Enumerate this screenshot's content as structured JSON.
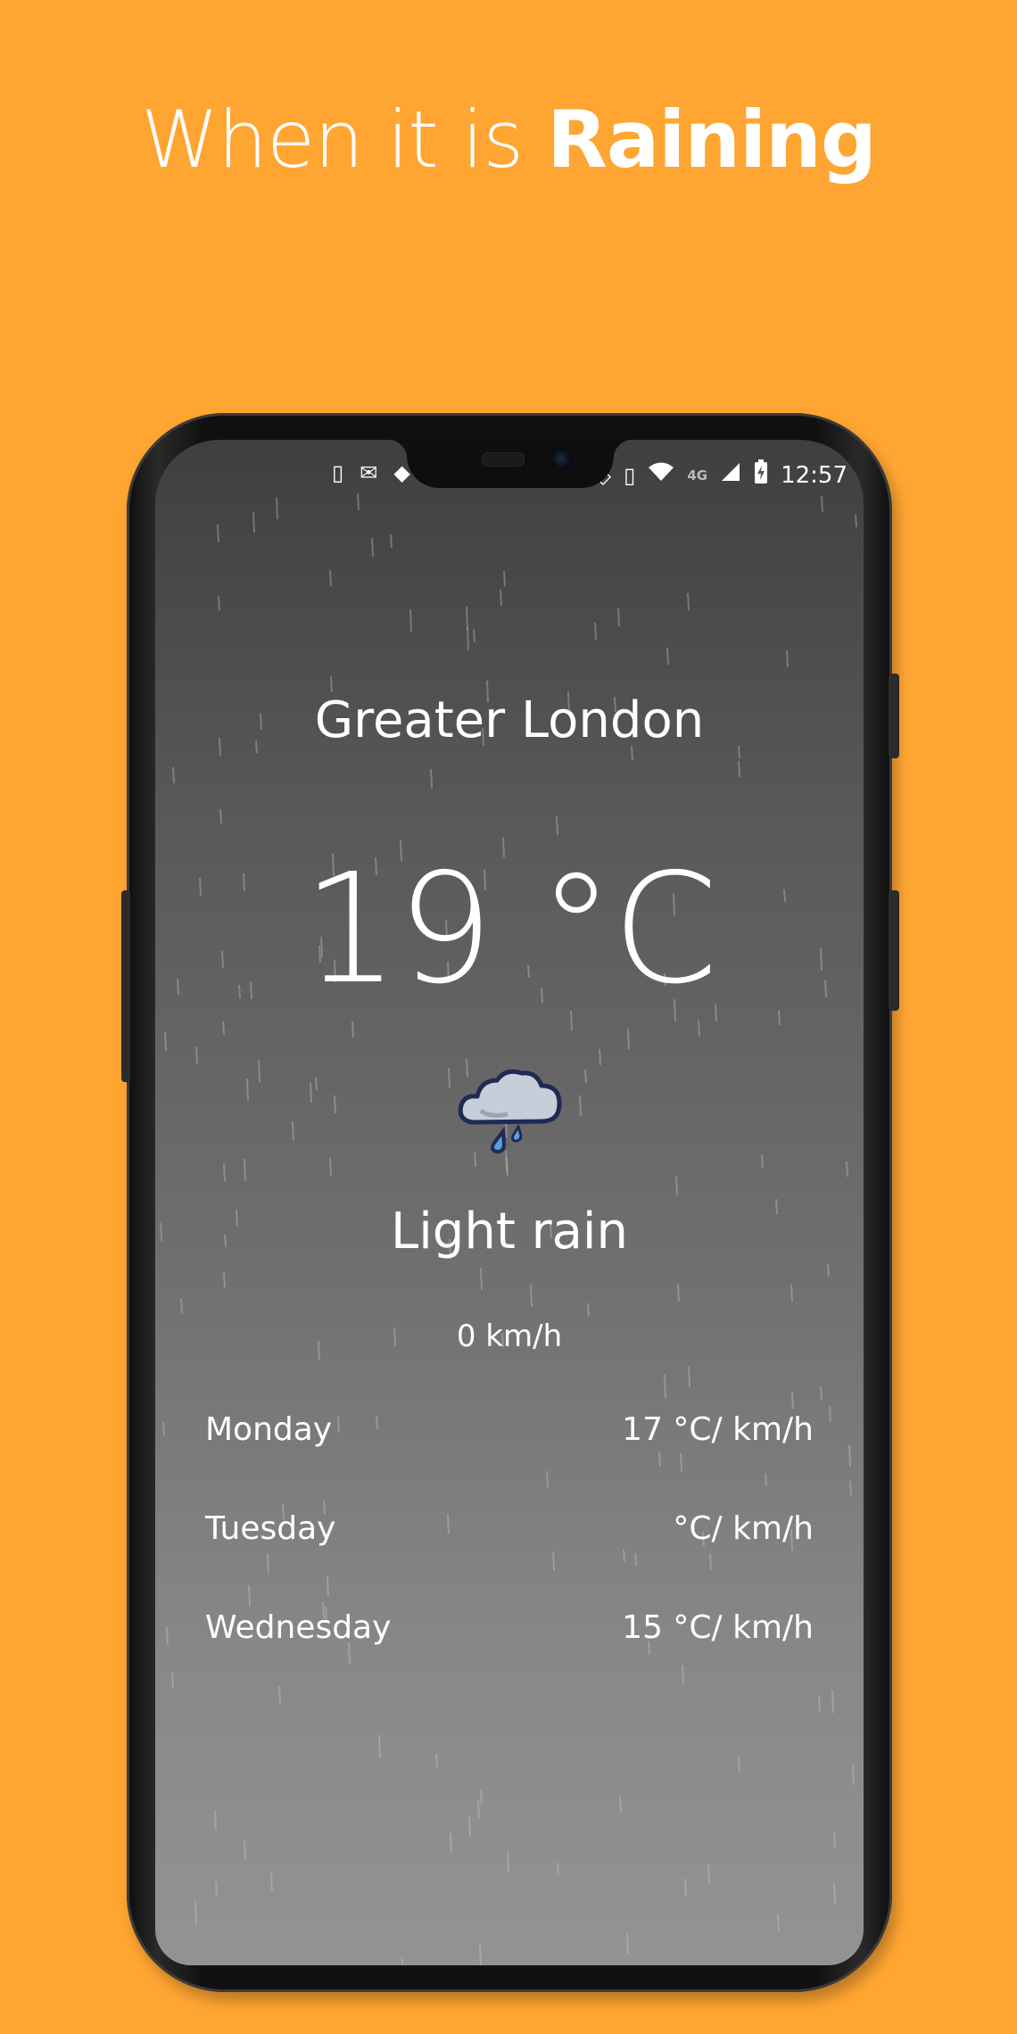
{
  "headline": {
    "prefix": "When it is",
    "emphasis": "Raining"
  },
  "status_bar": {
    "time": "12:57",
    "network": "4G",
    "icons_left": [
      "sync-phone-icon",
      "mail-icon",
      "android-icon",
      "blank-icon"
    ],
    "icons_right": [
      "location-icon",
      "vibrate-icon",
      "wifi-icon",
      "signal-icon",
      "battery-charging-icon"
    ]
  },
  "weather": {
    "city": "Greater London",
    "temperature": "19 °C",
    "condition": "Light rain",
    "condition_icon": "rain-cloud-icon",
    "wind": "0 km/h"
  },
  "forecast": [
    {
      "day": "Monday",
      "value": "17 °C/ km/h"
    },
    {
      "day": "Tuesday",
      "value": "°C/ km/h"
    },
    {
      "day": "Wednesday",
      "value": "15 °C/ km/h"
    }
  ],
  "colors": {
    "background": "#FFA531",
    "screen_top": "#3f3f3f",
    "screen_bottom": "#939393",
    "text": "#FFFFFF"
  }
}
